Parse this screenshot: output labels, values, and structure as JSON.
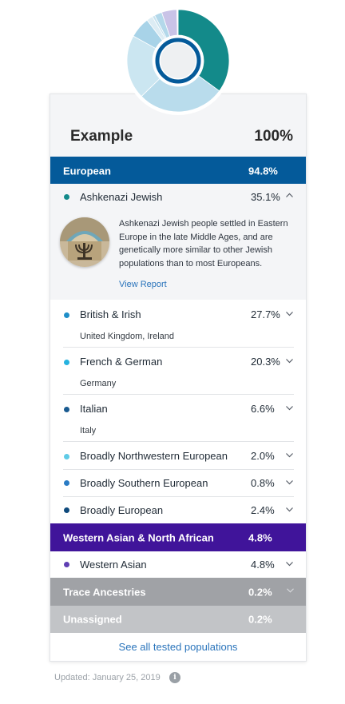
{
  "header": {
    "title": "Example",
    "percent": "100%"
  },
  "european": {
    "label": "European",
    "percent": "94.8%",
    "rows": [
      {
        "name": "Ashkenazi Jewish",
        "percent": "35.1%",
        "sub": "",
        "color": "#138a8a",
        "expanded": true,
        "description": "Ashkenazi Jewish people settled in Eastern Europe in the late Middle Ages, and are genetically more similar to other Jewish populations than to most Europeans.",
        "link": "View Report"
      },
      {
        "name": "British & Irish",
        "percent": "27.7%",
        "sub": "United Kingdom, Ireland",
        "color": "#1f8ec8"
      },
      {
        "name": "French & German",
        "percent": "20.3%",
        "sub": "Germany",
        "color": "#25b2df"
      },
      {
        "name": "Italian",
        "percent": "6.6%",
        "sub": "Italy",
        "color": "#195a90"
      },
      {
        "name": "Broadly Northwestern European",
        "percent": "2.0%",
        "color": "#5fcbe6"
      },
      {
        "name": "Broadly Southern European",
        "percent": "0.8%",
        "color": "#2a7bc4"
      },
      {
        "name": "Broadly European",
        "percent": "2.4%",
        "color": "#0e4a7c"
      }
    ]
  },
  "western_asian": {
    "label": "Western Asian & North African",
    "percent": "4.8%",
    "rows": [
      {
        "name": "Western Asian",
        "percent": "4.8%",
        "color": "#5f3fb3"
      }
    ]
  },
  "trace": {
    "label": "Trace Ancestries",
    "percent": "0.2%"
  },
  "unassigned": {
    "label": "Unassigned",
    "percent": "0.2%"
  },
  "footer": {
    "see_all": "See all tested populations",
    "updated": "Updated: January 25, 2019"
  },
  "colors": {
    "european": "#045a9a",
    "western_asian": "#40149a",
    "trace": "#a0a2a6",
    "unassigned": "#c2c4c7",
    "link": "#2a74bb"
  },
  "icons": {
    "expand": "chevron-down-icon",
    "collapse": "chevron-up-icon",
    "info": "info-icon"
  },
  "chart_data": {
    "type": "pie",
    "style": "donut",
    "categories": [
      "Ashkenazi Jewish",
      "British & Irish",
      "French & German",
      "Italian",
      "Broadly Northwestern European",
      "Broadly Southern European",
      "Broadly European",
      "Western Asian",
      "Trace Ancestries",
      "Unassigned"
    ],
    "values": [
      35.1,
      27.7,
      20.3,
      6.6,
      2.0,
      0.8,
      2.4,
      4.8,
      0.2,
      0.2
    ],
    "colors": [
      "#138a8a",
      "#b9dcec",
      "#cbe6f1",
      "#a8d3e8",
      "#dcecf4",
      "#c6e1ee",
      "#b3d8ea",
      "#c9c3e7",
      "#d3d6da",
      "#e2e4e7"
    ],
    "title": "",
    "xlabel": "",
    "ylabel": ""
  }
}
